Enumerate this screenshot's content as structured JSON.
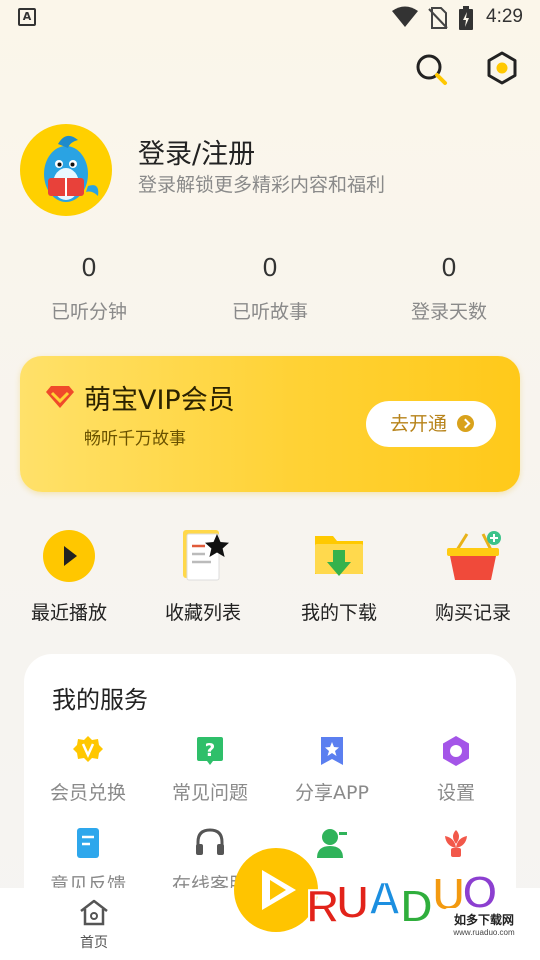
{
  "status_bar": {
    "time": "4:29",
    "left_glyph": "A"
  },
  "icons": {
    "search": "search-icon",
    "settings": "settings-hexagon-icon"
  },
  "profile": {
    "title": "登录/注册",
    "subtitle": "登录解锁更多精彩内容和福利"
  },
  "stats": [
    {
      "value": "0",
      "label": "已听分钟"
    },
    {
      "value": "0",
      "label": "已听故事"
    },
    {
      "value": "0",
      "label": "登录天数"
    }
  ],
  "vip": {
    "title": "萌宝VIP会员",
    "subtitle": "畅听千万故事",
    "button": "去开通"
  },
  "quick_actions": [
    {
      "label": "最近播放",
      "icon": "play-icon"
    },
    {
      "label": "收藏列表",
      "icon": "favorites-star-icon"
    },
    {
      "label": "我的下载",
      "icon": "download-folder-icon"
    },
    {
      "label": "购买记录",
      "icon": "shopping-basket-icon"
    }
  ],
  "services": {
    "title": "我的服务",
    "items": [
      {
        "label": "会员兑换",
        "icon": "vip-badge-icon"
      },
      {
        "label": "常见问题",
        "icon": "question-icon"
      },
      {
        "label": "分享APP",
        "icon": "share-star-icon"
      },
      {
        "label": "设置",
        "icon": "settings-icon"
      },
      {
        "label": "意见反馈",
        "icon": "feedback-document-icon"
      },
      {
        "label": "在线客服",
        "icon": "headset-icon"
      },
      {
        "label": "",
        "icon": "contact-person-icon"
      },
      {
        "label": "",
        "icon": "flower-icon"
      }
    ]
  },
  "bottom_nav": {
    "home_label": "首页"
  },
  "watermark": {
    "brand": "RUANDUO",
    "tagline": "如多下载网",
    "url": "www.ruaduo.com"
  },
  "colors": {
    "accent_yellow": "#ffd235",
    "vip_button_text": "#b7831a",
    "text_gray": "#8a8a8a"
  }
}
